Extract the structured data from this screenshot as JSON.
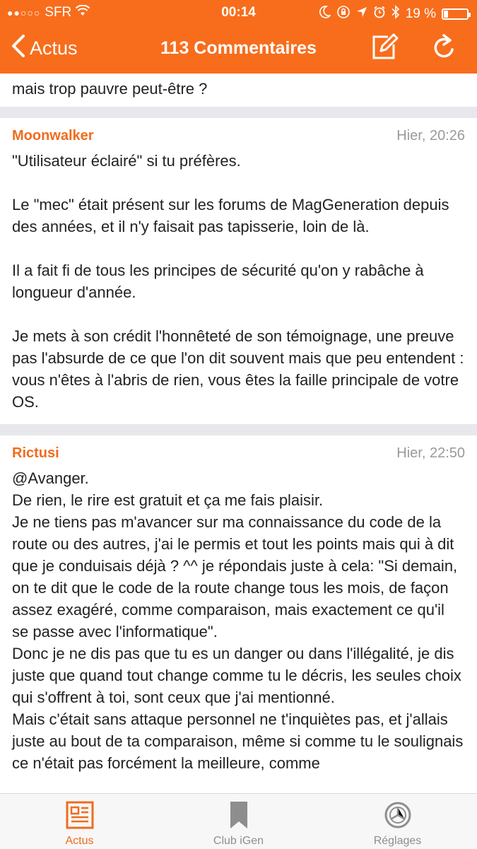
{
  "status_bar": {
    "carrier": "SFR",
    "time": "00:14",
    "battery_percent": "19 %",
    "battery_level": 0.19,
    "left_icons": [
      "signal-dots-icon",
      "wifi-icon"
    ],
    "right_icons": [
      "moon-icon",
      "orientation-lock-icon",
      "location-arrow-icon",
      "alarm-icon",
      "bluetooth-icon",
      "battery-icon"
    ]
  },
  "nav": {
    "back_label": "Actus",
    "title": "113 Commentaires",
    "actions": [
      "compose-icon",
      "refresh-icon"
    ]
  },
  "partial_comment": {
    "text": "mais trop pauvre peut-être ?"
  },
  "comments": [
    {
      "author": "Moonwalker",
      "time": "Hier, 20:26",
      "paragraphs": [
        "\"Utilisateur éclairé\" si tu préfères.",
        "Le \"mec\" était présent sur les forums de MagGeneration depuis des années, et il n'y faisait pas tapisserie, loin de là.",
        "Il a fait fi de tous les principes de sécurité qu'on y rabâche à longueur d'année.",
        "Je mets à son crédit l'honnêteté de son témoignage, une preuve pas l'absurde de ce que l'on dit souvent mais que peu entendent : vous n'êtes à l'abris de rien, vous êtes la faille principale de votre OS."
      ]
    },
    {
      "author": "Rictusi",
      "time": "Hier, 22:50",
      "lines": [
        "@Avanger.",
        "De rien, le rire est gratuit et ça me fais plaisir.",
        "Je ne tiens pas m'avancer sur ma connaissance du code de la route ou des autres, j'ai le permis et tout les points mais qui à dit que je conduisais déjà ? ^^ je répondais juste à cela: \"Si demain, on te dit que le code de la route change tous les mois, de façon assez exagéré, comme comparaison, mais exactement ce qu'il se passe avec l'informatique\".",
        "Donc je ne dis pas que tu es un danger ou dans l'illégalité, je dis juste que quand tout change comme tu le décris, les seules choix qui s'offrent à toi, sont ceux que j'ai mentionné.",
        "Mais c'était sans attaque personnel ne t'inquiètes pas, et j'allais juste au bout de ta comparaison, même si comme tu le soulignais ce n'était pas forcément la meilleure, comme"
      ]
    }
  ],
  "tabs": [
    {
      "label": "Actus",
      "icon": "newspaper-icon",
      "active": true
    },
    {
      "label": "Club iGen",
      "icon": "bookmark-icon",
      "active": false
    },
    {
      "label": "Réglages",
      "icon": "settings-wheel-icon",
      "active": false
    }
  ],
  "colors": {
    "accent": "#f86d1c",
    "author": "#f06c1c",
    "separator": "#e8e8ec",
    "timestamp": "#9a9a9a"
  }
}
